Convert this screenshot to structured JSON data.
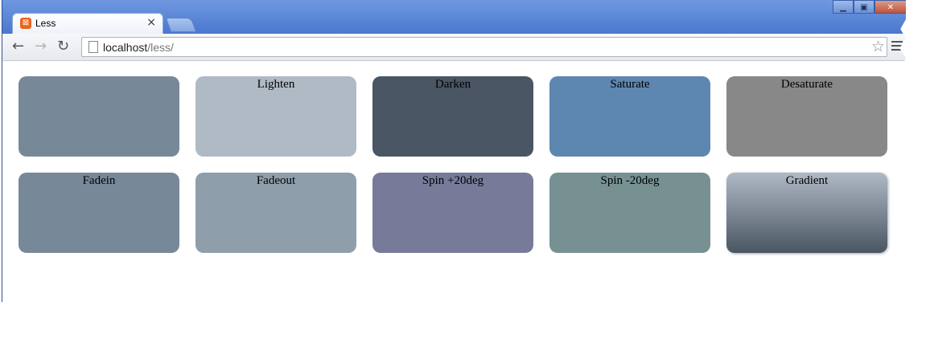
{
  "browser": {
    "tab_title": "Less",
    "tab_icon": "xampp-icon",
    "close_glyph": "×",
    "url_host": "localhost",
    "url_path": "/less/"
  },
  "boxes": [
    {
      "label": "",
      "color": "#778899"
    },
    {
      "label": "Lighten",
      "color": "#b0bac5"
    },
    {
      "label": "Darken",
      "color": "#4a5663"
    },
    {
      "label": "Saturate",
      "color": "#5d87b0"
    },
    {
      "label": "Desaturate",
      "color": "#888888"
    },
    {
      "label": "Fadein",
      "color": "#778899"
    },
    {
      "label": "Fadeout",
      "color": "#8f9eab"
    },
    {
      "label": "Spin +20deg",
      "color": "#777b99"
    },
    {
      "label": "Spin -20deg",
      "color": "#779193"
    },
    {
      "label": "Gradient",
      "gradient_from": "#b0bac5",
      "gradient_to": "#4a5663"
    }
  ]
}
